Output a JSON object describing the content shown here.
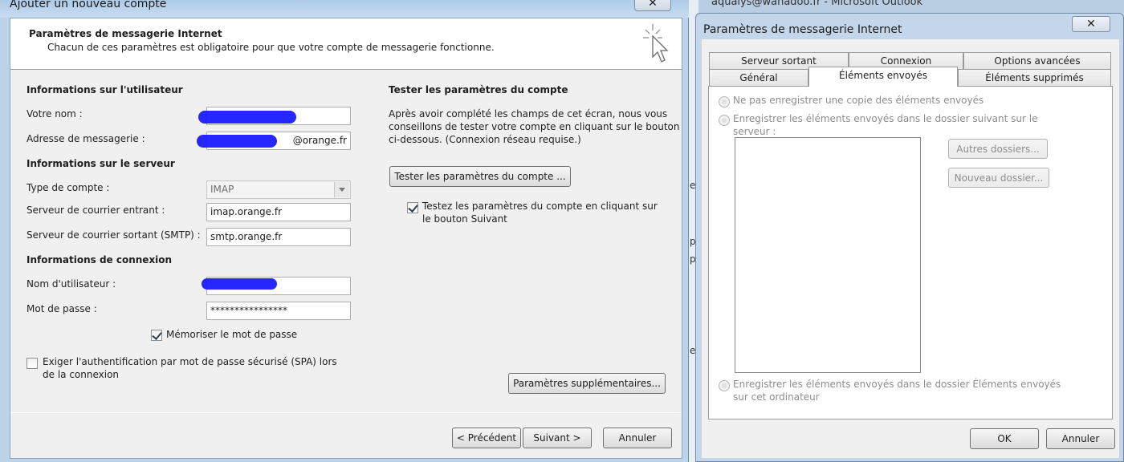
{
  "left_window": {
    "title": "Ajouter un nouveau compte",
    "close_glyph": "✕",
    "header": {
      "title": "Paramètres de messagerie Internet",
      "subtitle": "Chacun de ces paramètres est obligatoire pour que votre compte de messagerie fonctionne.",
      "icon": "cursor-click-icon"
    },
    "user_info": {
      "title": "Informations sur l'utilisateur",
      "name_label": "Votre nom :",
      "email_label": "Adresse de messagerie :",
      "email_value": "@orange.fr"
    },
    "server_info": {
      "title": "Informations sur le serveur",
      "account_type_label": "Type de compte :",
      "account_type_value": "IMAP",
      "incoming_label": "Serveur de courrier entrant :",
      "incoming_value": "imap.orange.fr",
      "outgoing_label": "Serveur de courrier sortant (SMTP) :",
      "outgoing_value": "smtp.orange.fr"
    },
    "login_info": {
      "title": "Informations de connexion",
      "username_label": "Nom d'utilisateur :",
      "password_label": "Mot de passe :",
      "password_value": "****************",
      "remember_label": "Mémoriser le mot de passe",
      "remember_checked": true,
      "spa_label_line1": "Exiger l'authentification par mot de passe sécurisé (SPA) lors",
      "spa_label_line2": "de la connexion",
      "spa_checked": false
    },
    "test": {
      "title": "Tester les paramètres du compte",
      "desc_line1": "Après avoir complété les champs de cet écran, nous vous",
      "desc_line2": "conseillons de tester votre compte en cliquant sur le bouton",
      "desc_line3": "ci-dessous. (Connexion réseau requise.)",
      "test_button": "Tester les paramètres du compte ...",
      "auto_test_line1": "Testez les paramètres du compte en cliquant sur",
      "auto_test_line2": "le bouton Suivant",
      "auto_test_checked": true,
      "more_settings_button": "Paramètres supplémentaires..."
    },
    "footer": {
      "prev_button": "< Précédent",
      "next_button": "Suivant >",
      "cancel_button": "Annuler"
    }
  },
  "background": {
    "title_fragment": "aqualys@wanadoo.fr - Microsoft Outlook",
    "edge_chars": [
      "e",
      "p",
      "p",
      "e"
    ]
  },
  "right_window": {
    "title": "Paramètres de messagerie Internet",
    "close_glyph": "✕",
    "tabs_row1": [
      "Serveur sortant",
      "Connexion",
      "Options avancées"
    ],
    "tabs_row2": [
      "Général",
      "Éléments envoyés",
      "Éléments supprimés"
    ],
    "active_tab": "Éléments envoyés",
    "options": {
      "no_copy": "Ne pas enregistrer une copie des éléments envoyés",
      "server_folder_line1": "Enregistrer les éléments envoyés dans le dossier suivant sur le",
      "server_folder_line2": "serveur :",
      "local_line1": "Enregistrer les éléments envoyés dans le dossier Éléments envoyés",
      "local_line2": "sur cet ordinateur"
    },
    "other_folders_button": "Autres dossiers...",
    "new_folder_button": "Nouveau dossier...",
    "ok_button": "OK",
    "cancel_button": "Annuler"
  }
}
